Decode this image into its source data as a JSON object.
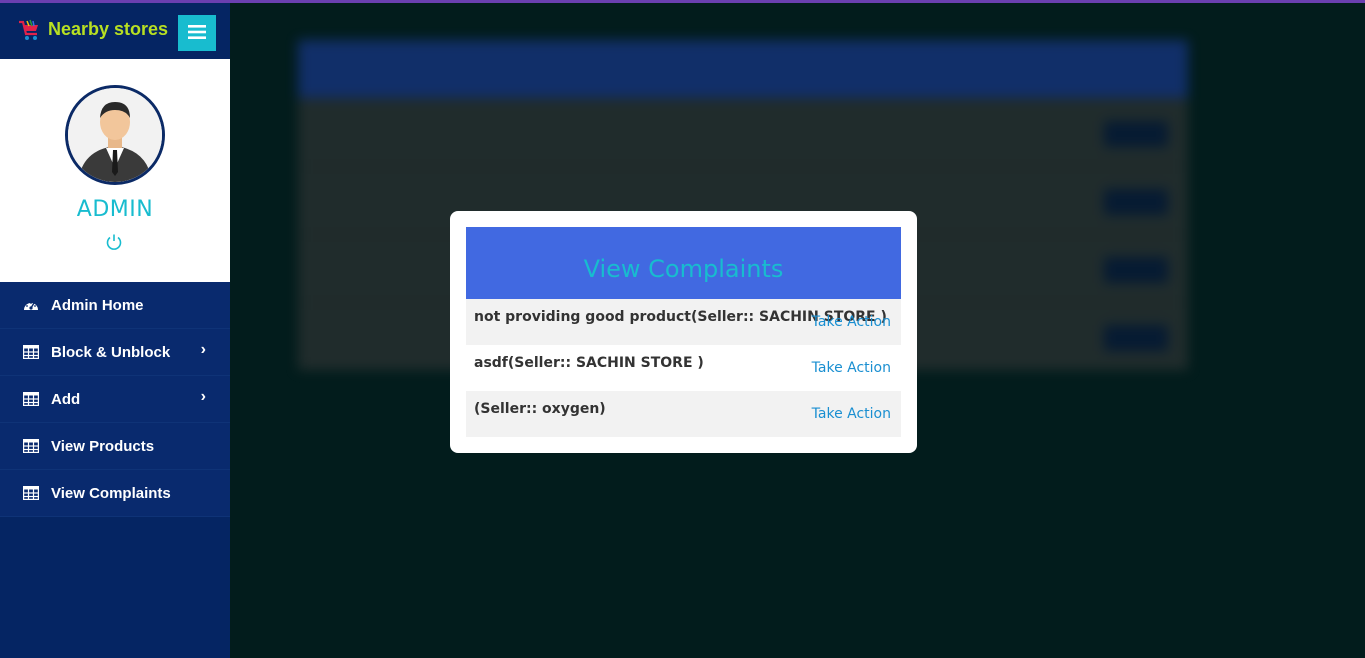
{
  "brand": {
    "title": "Nearby stores",
    "logo_icon": "shopping-cart-icon",
    "menu_icon": "hamburger-icon"
  },
  "profile": {
    "name": "ADMIN",
    "avatar_icon": "businessman-avatar",
    "power_icon": "power-icon"
  },
  "nav": {
    "items": [
      {
        "label": "Admin Home",
        "icon": "dashboard-icon",
        "has_chevron": false
      },
      {
        "label": "Block & Unblock",
        "icon": "table-icon",
        "has_chevron": true
      },
      {
        "label": "Add",
        "icon": "table-icon",
        "has_chevron": true
      },
      {
        "label": "View Products",
        "icon": "table-icon",
        "has_chevron": false
      },
      {
        "label": "View Complaints",
        "icon": "table-icon",
        "has_chevron": false
      }
    ]
  },
  "modal": {
    "title": "View Complaints",
    "rows": [
      {
        "text": "not providing good product(Seller:: SACHIN STORE )",
        "action": "Take Action"
      },
      {
        "text": "asdf(Seller:: SACHIN STORE )",
        "action": "Take Action"
      },
      {
        "text": "(Seller:: oxygen)",
        "action": "Take Action"
      }
    ]
  },
  "colors": {
    "sidebar": "#052563",
    "accent": "#18bccf",
    "brand": "#b8e022",
    "modal_header": "#4169e1",
    "link": "#1a8fd1"
  }
}
